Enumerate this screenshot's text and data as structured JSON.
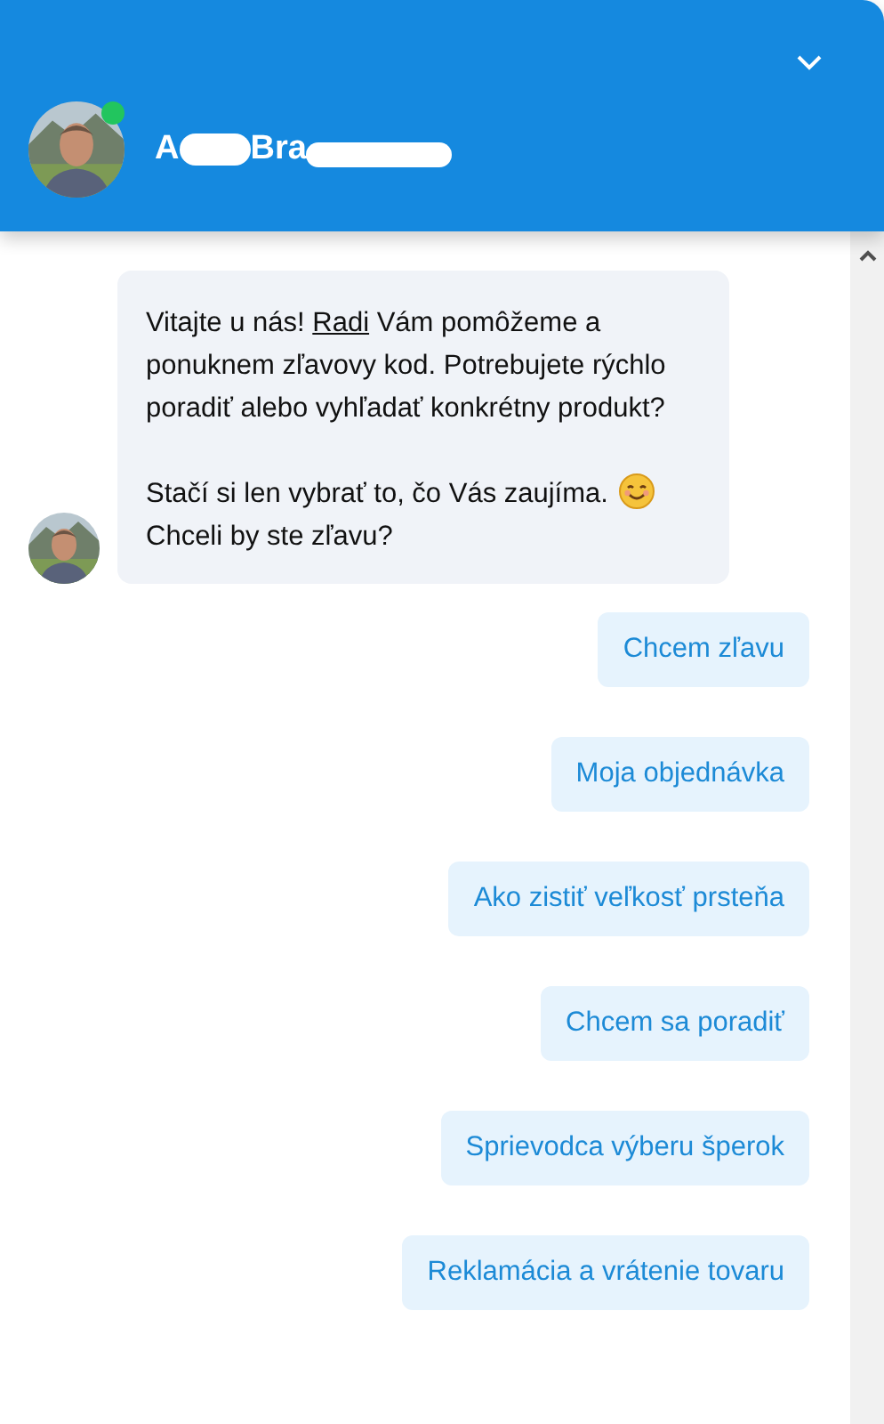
{
  "header": {
    "agent_name_parts": [
      "A",
      "Bra"
    ],
    "online": true
  },
  "message": {
    "before_link": "Vitajte u nás! ",
    "link": "Radi",
    "after_link": " Vám pomôžeme a ponuknem zľavovy kod. Potrebujete rýchlo poradiť alebo vyhľadať konkrétny produkt?",
    "line_before_emoji": " Stačí si len vybrať to, čo Vás zaujíma.",
    "line_after_emoji": "Chceli by ste zľavu?"
  },
  "quick_replies": [
    "Chcem zľavu",
    "Moja objednávka",
    "Ako zistiť veľkosť prsteňa",
    "Chcem sa poradiť",
    "Sprievodca výberu šperok",
    "Reklamácia a vrátenie tovaru"
  ]
}
